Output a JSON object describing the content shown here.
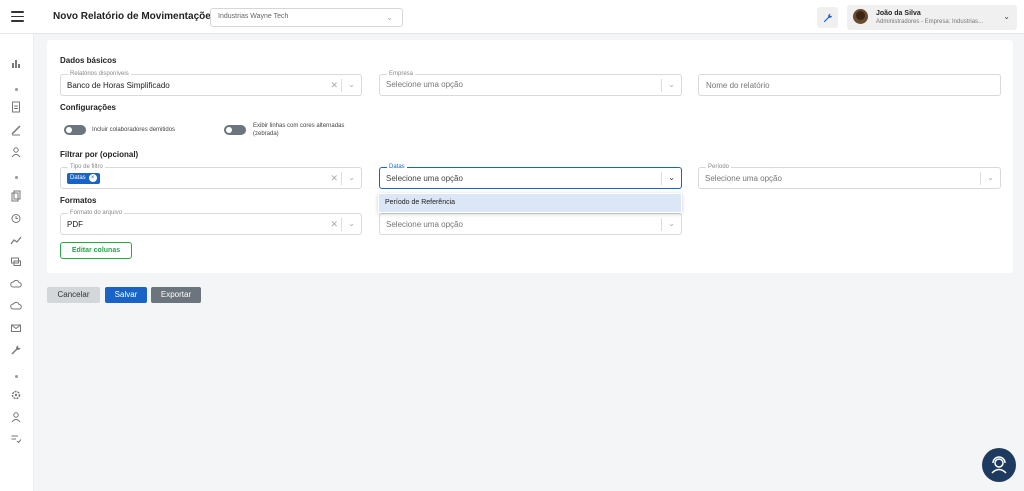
{
  "header": {
    "title": "Novo Relatório de Movimentações",
    "company_select": "Industrias Wayne Tech",
    "user_name": "João da Silva",
    "user_role": "Administradores - Empresa: Industrias..."
  },
  "sections": {
    "basic": "Dados básicos",
    "config": "Configurações",
    "filter": "Filtrar por (opcional)",
    "formats": "Formatos"
  },
  "fields": {
    "reports": {
      "label": "Relatórios disponíveis",
      "value": "Banco de Horas Simplificado"
    },
    "company": {
      "label": "Empresa",
      "placeholder": "Selecione uma opção"
    },
    "report_name": {
      "placeholder": "Nome do relatório"
    },
    "filter_type": {
      "label": "Tipo de filtro",
      "chip": "Datas"
    },
    "dates": {
      "label": "Datas",
      "placeholder": "Selecione uma opção"
    },
    "period": {
      "label": "Período",
      "placeholder": "Selecione uma opção"
    },
    "file_format": {
      "label": "Formato do arquivo",
      "value": "PDF"
    },
    "hidden_select": {
      "placeholder": "Selecione uma opção"
    }
  },
  "toggles": {
    "include_fired": "Incluir colaboradores demitidos",
    "zebra_line1": "Exibir linhas com cores alternadas",
    "zebra_line2": "(zebrada)"
  },
  "dropdown": {
    "option": "Período de Referência"
  },
  "buttons": {
    "edit_columns": "Editar colunas",
    "cancel": "Cancelar",
    "save": "Salvar",
    "export": "Exportar"
  },
  "colors": {
    "primary": "#1a63c6",
    "success": "#28a745",
    "secondary": "#6c757d"
  }
}
